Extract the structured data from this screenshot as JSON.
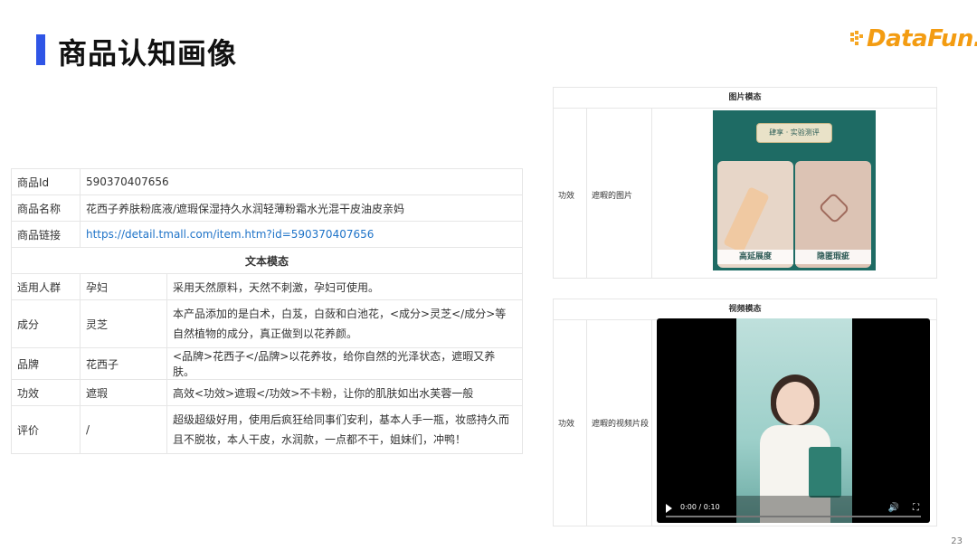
{
  "header": {
    "title": "商品认知画像",
    "logo": "DataFun."
  },
  "product": {
    "rows": [
      {
        "label": "商品Id",
        "value": "590370407656"
      },
      {
        "label": "商品名称",
        "value": "花西子养肤粉底液/遮瑕保湿持久水润轻薄粉霜水光混干皮油皮亲妈"
      },
      {
        "label": "商品链接",
        "value": "https://detail.tmall.com/item.htm?id=590370407656"
      }
    ],
    "text_section_title": "文本模态",
    "text_rows": [
      {
        "label": "适用人群",
        "key": "孕妇",
        "desc": "采用天然原料，天然不刺激，孕妇可使用。"
      },
      {
        "label": "成分",
        "key": "灵芝",
        "desc": "本产品添加的是白术，白芨，白蔹和白池花，<成分>灵芝</成分>等自然植物的成分，真正做到以花养颜。"
      },
      {
        "label": "品牌",
        "key": "花西子",
        "desc": "<品牌>花西子</品牌>以花养妆，给你自然的光泽状态，遮暇又养肤。"
      },
      {
        "label": "功效",
        "key": "遮瑕",
        "desc": "高效<功效>遮瑕</功效>不卡粉，让你的肌肤如出水芙蓉一般"
      },
      {
        "label": "评价",
        "key": "/",
        "desc": "超级超级好用，使用后疯狂给同事们安利，基本人手一瓶，妆感持久而且不脱妆，本人干皮，水润款，一点都不干，姐妹们，冲鸭！"
      }
    ]
  },
  "image_panel": {
    "title": "图片模态",
    "label": "功效",
    "desc": "遮暇的图片",
    "banner": "肆享 · 实验测评",
    "cap_left": "高延展度",
    "cap_right": "隐匿瑕疵"
  },
  "video_panel": {
    "title": "视频模态",
    "label": "功效",
    "desc": "遮暇的视频片段",
    "time": "0:00 / 0:10"
  },
  "page_number": "23"
}
